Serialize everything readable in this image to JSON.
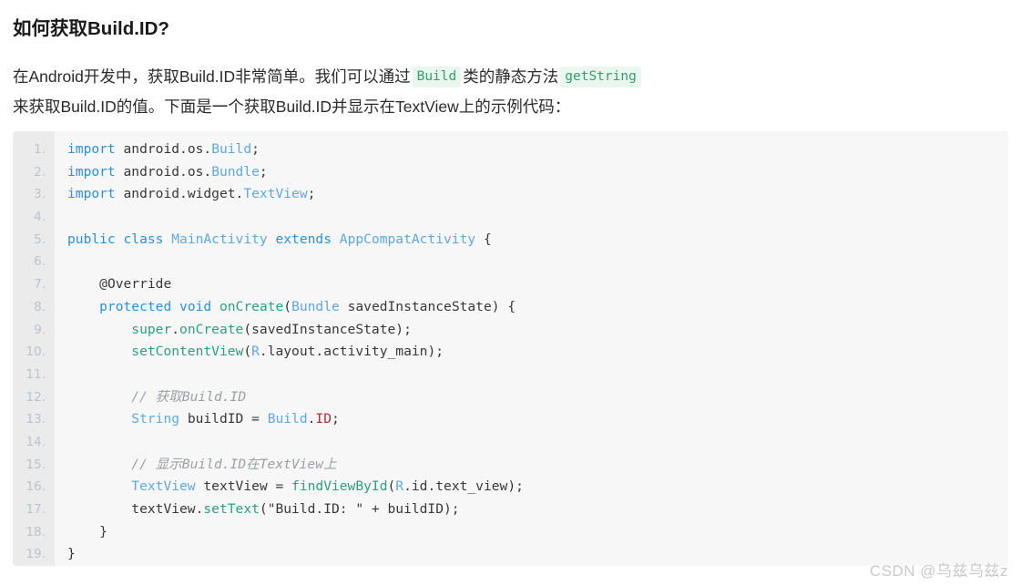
{
  "article": {
    "heading": "如何获取Build.ID?",
    "paragraph": {
      "seg1": "在Android开发中，获取Build.ID非常简单。我们可以通过",
      "chip1": "Build",
      "seg2": "类的静态方法",
      "chip2": "getString",
      "seg3": "来获取Build.ID的值。下面是一个获取Build.ID并显示在TextView上的示例代码："
    }
  },
  "code_block": {
    "language": "java",
    "line_numbers": [
      "1.",
      "2.",
      "3.",
      "4.",
      "5.",
      "6.",
      "7.",
      "8.",
      "9.",
      "10.",
      "11.",
      "12.",
      "13.",
      "14.",
      "15.",
      "16.",
      "17.",
      "18.",
      "19."
    ],
    "lines": [
      "import android.os.Build;",
      "import android.os.Bundle;",
      "import android.widget.TextView;",
      "",
      "public class MainActivity extends AppCompatActivity {",
      "",
      "    @Override",
      "    protected void onCreate(Bundle savedInstanceState) {",
      "        super.onCreate(savedInstanceState);",
      "        setContentView(R.layout.activity_main);",
      "",
      "        // 获取Build.ID",
      "        String buildID = Build.ID;",
      "",
      "        // 显示Build.ID在TextView上",
      "        TextView textView = findViewById(R.id.text_view);",
      "        textView.setText(\"Build.ID: \" + buildID);",
      "    }",
      "}"
    ]
  },
  "watermark": {
    "text": "CSDN @乌兹乌兹z"
  },
  "colors": {
    "keyword": "#2b91d6",
    "type": "#5fa8dd",
    "function": "#2e9e7e",
    "comment": "#9aa0a6",
    "constant": "#a6302f",
    "plain": "#383838",
    "inline_code_bg": "#e9f7ef",
    "inline_code_fg": "#2ea26c",
    "code_bg": "#f7f7f7",
    "gutter_bg": "#ebebeb",
    "line_number": "#b9c3cc",
    "watermark": "#c9c9c9"
  }
}
